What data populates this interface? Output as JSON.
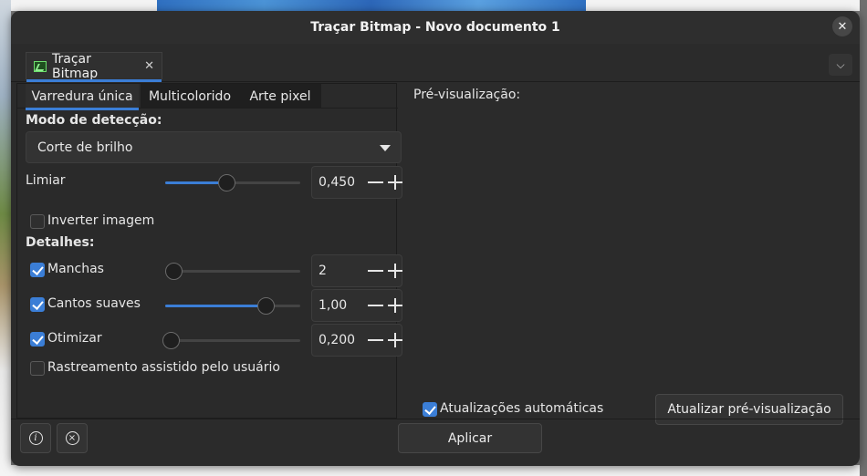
{
  "window": {
    "title": "Traçar Bitmap - Novo documento 1",
    "close_glyph": "✕"
  },
  "doc_tab": {
    "label": "Traçar Bitmap",
    "close_glyph": "✕",
    "icon": "trace-bitmap-icon"
  },
  "menu_glyph": "⌵",
  "mode_tabs": [
    {
      "label": "Varredura única",
      "active": true
    },
    {
      "label": "Multicolorido",
      "active": false
    },
    {
      "label": "Arte pixel",
      "active": false
    }
  ],
  "detection": {
    "heading": "Modo de detecção:",
    "selected": "Corte de brilho"
  },
  "threshold": {
    "label": "Limiar",
    "value": "0,450",
    "slider_fraction": 0.45
  },
  "invert": {
    "label": "Inverter imagem",
    "checked": false
  },
  "details": {
    "heading": "Detalhes:",
    "speckles": {
      "label": "Manchas",
      "checked": true,
      "value": "2",
      "slider_fraction": 0.0
    },
    "smooth_corners": {
      "label": "Cantos suaves",
      "checked": true,
      "value": "1,00",
      "slider_fraction": 0.74
    },
    "optimize": {
      "label": "Otimizar",
      "checked": true,
      "value": "0,200",
      "slider_fraction": 0.04
    }
  },
  "assisted": {
    "label": "Rastreamento assistido pelo usuário",
    "checked": false
  },
  "preview": {
    "heading": "Pré-visualização:",
    "auto_updates_label": "Atualizações automáticas",
    "auto_updates_checked": true,
    "update_button": "Atualizar pré-visualização"
  },
  "footer": {
    "info_glyph": "i",
    "stop_glyph": "×",
    "apply": "Aplicar"
  },
  "colors": {
    "accent": "#3b7ed6",
    "dialog_bg": "#2b2b2b"
  }
}
